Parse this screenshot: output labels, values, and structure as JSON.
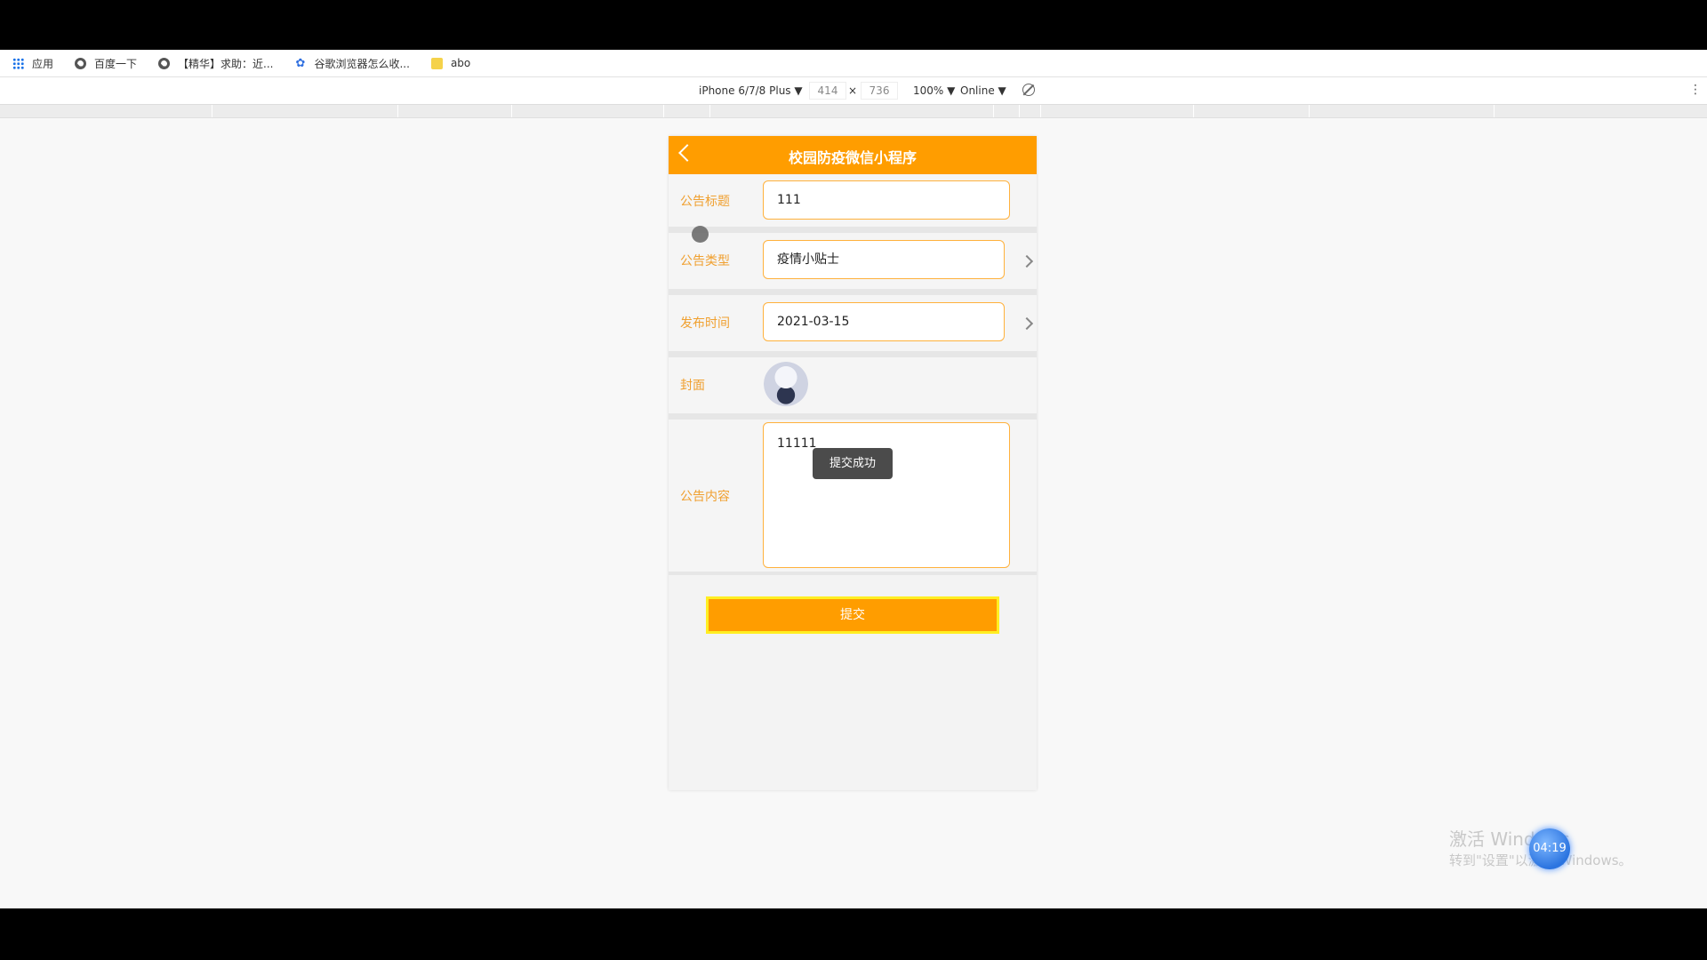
{
  "bookmarks": [
    {
      "label": "应用",
      "icon": "apps-grid-icon"
    },
    {
      "label": "百度一下",
      "icon": "globe-icon"
    },
    {
      "label": "【精华】求助：近...",
      "icon": "globe-icon"
    },
    {
      "label": "谷歌浏览器怎么收...",
      "icon": "paw-icon"
    },
    {
      "label": "abo",
      "icon": "folder-icon"
    }
  ],
  "devtools": {
    "device": "iPhone 6/7/8 Plus ▼",
    "width": "414",
    "times": "×",
    "height": "736",
    "zoom": "100% ▼",
    "network": "Online ▼"
  },
  "app": {
    "title": "校园防疫微信小程序",
    "form": {
      "title_label": "公告标题",
      "title_value": "111",
      "type_label": "公告类型",
      "type_value": "疫情小贴士",
      "date_label": "发布时间",
      "date_value": "2021-03-15",
      "cover_label": "封面",
      "content_label": "公告内容",
      "content_value": "11111"
    },
    "submit_label": "提交",
    "toast": "提交成功"
  },
  "watermark": {
    "line1": "激活 Windows",
    "line2": "转到\"设置\"以激活 Windows。"
  },
  "timer": "04:19",
  "colors": {
    "accent": "#ff9d00",
    "label": "#f0a030",
    "field_border": "#ffb13c"
  }
}
